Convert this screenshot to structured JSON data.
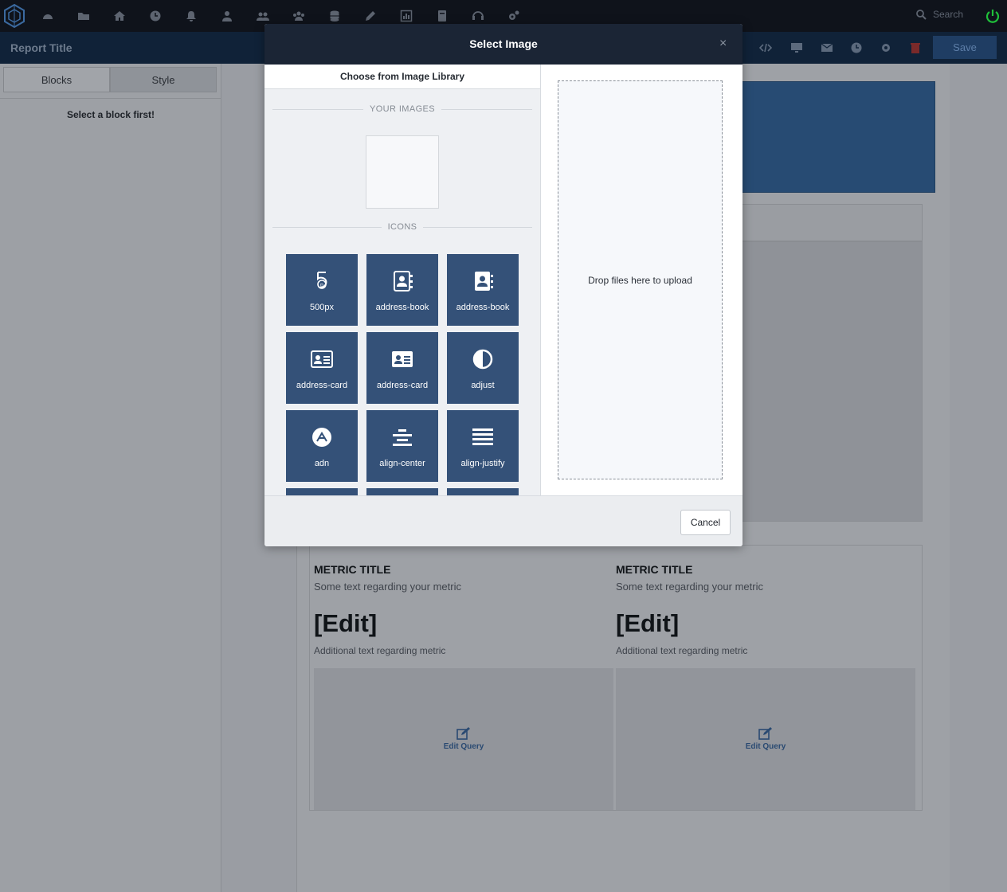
{
  "app": {
    "report_title": "Report Title",
    "search_placeholder": "Search",
    "save_label": "Save"
  },
  "nav_icons": [
    "dashboard-icon",
    "folder-icon",
    "home-icon",
    "clock-icon",
    "bell-icon",
    "user-icon",
    "users-icon",
    "group-icon",
    "database-icon",
    "pencil-icon",
    "chart-icon",
    "book-icon",
    "headset-icon",
    "cogs-icon"
  ],
  "toolbar_icons": [
    "code-icon",
    "desktop-icon",
    "envelope-icon",
    "clock-icon",
    "gear-icon",
    "trash-icon"
  ],
  "left_panel": {
    "tabs": [
      {
        "label": "Blocks"
      },
      {
        "label": "Style"
      }
    ],
    "empty_message": "Select a block first!"
  },
  "metrics": [
    {
      "title": "METRIC TITLE",
      "subtitle": "Some text regarding your metric",
      "value": "[Edit]",
      "additional": "Additional text regarding metric",
      "query_label": "Edit Query"
    },
    {
      "title": "METRIC TITLE",
      "subtitle": "Some text regarding your metric",
      "value": "[Edit]",
      "additional": "Additional text regarding metric",
      "query_label": "Edit Query"
    }
  ],
  "modal": {
    "title": "Select Image",
    "close": "×",
    "library_tab": "Choose from Image Library",
    "your_images_label": "YOUR IMAGES",
    "icons_label": "ICONS",
    "icons": [
      {
        "label": "500px",
        "icon": "500px-icon"
      },
      {
        "label": "address-book",
        "icon": "address-book-icon"
      },
      {
        "label": "address-book",
        "icon": "address-book-icon"
      },
      {
        "label": "address-card",
        "icon": "address-card-icon"
      },
      {
        "label": "address-card",
        "icon": "address-card-icon"
      },
      {
        "label": "adjust",
        "icon": "adjust-icon"
      },
      {
        "label": "adn",
        "icon": "adn-icon"
      },
      {
        "label": "align-center",
        "icon": "align-center-icon"
      },
      {
        "label": "align-justify",
        "icon": "align-justify-icon"
      }
    ],
    "drop_text": "Drop files here to upload",
    "cancel_label": "Cancel"
  },
  "colors": {
    "modal_header": "#1b2535",
    "tile": "#345178",
    "accent": "#274b73",
    "power": "#1fbf3a"
  }
}
